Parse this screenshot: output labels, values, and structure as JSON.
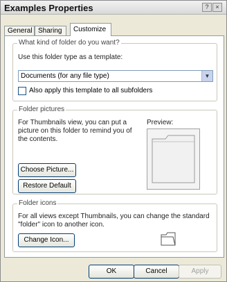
{
  "window": {
    "title": "Examples Properties",
    "help_glyph": "?",
    "close_glyph": "×"
  },
  "tabs": [
    {
      "label": "General",
      "active": false
    },
    {
      "label": "Sharing",
      "active": false
    },
    {
      "label": "Customize",
      "active": true
    }
  ],
  "folder_type": {
    "group_label": "What kind of folder do you want?",
    "template_label": "Use this folder type as a template:",
    "selected_value": "Documents (for any file type)",
    "dropdown_arrow": "▼",
    "checkbox_label": "Also apply this template to all subfolders",
    "checkbox_checked": false
  },
  "folder_pictures": {
    "group_label": "Folder pictures",
    "description": "For Thumbnails view, you can put a picture on this folder to remind you of the contents.",
    "preview_label": "Preview:",
    "choose_button": "Choose Picture...",
    "restore_button": "Restore Default"
  },
  "folder_icons": {
    "group_label": "Folder icons",
    "description": "For all views except Thumbnails, you can change the standard \"folder\" icon to another icon.",
    "change_button": "Change Icon..."
  },
  "footer": {
    "ok": "OK",
    "cancel": "Cancel",
    "apply": "Apply"
  },
  "icons": {
    "preview_folder": "folder-icon",
    "small_folder": "folder-icon"
  }
}
